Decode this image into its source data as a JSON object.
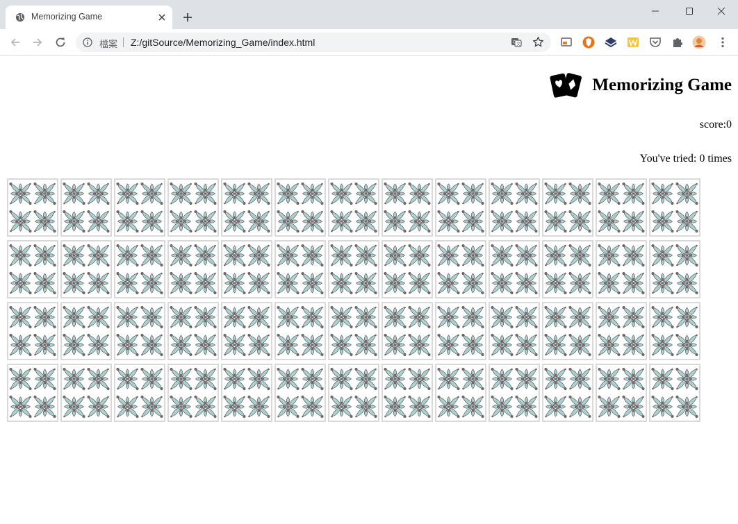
{
  "browser": {
    "tab_title": "Memorizing Game",
    "security_label": "檔案",
    "url": "Z:/gitSource/Memorizing_Game/index.html"
  },
  "page": {
    "title": "Memorizing Game",
    "score_label": "score:",
    "score": "0",
    "tries_prefix": "You've tried: ",
    "tries": "0",
    "tries_suffix": " times"
  },
  "board": {
    "rows": 4,
    "columns": 13,
    "card_back_pattern": "floral-tile",
    "colors": {
      "leaf": "#a9d3d1",
      "ink": "#6f6769",
      "card_border": "#d9d9d9"
    }
  },
  "colors": {
    "tabstrip": "#dee1e6",
    "omnibox": "#f1f3f4"
  }
}
